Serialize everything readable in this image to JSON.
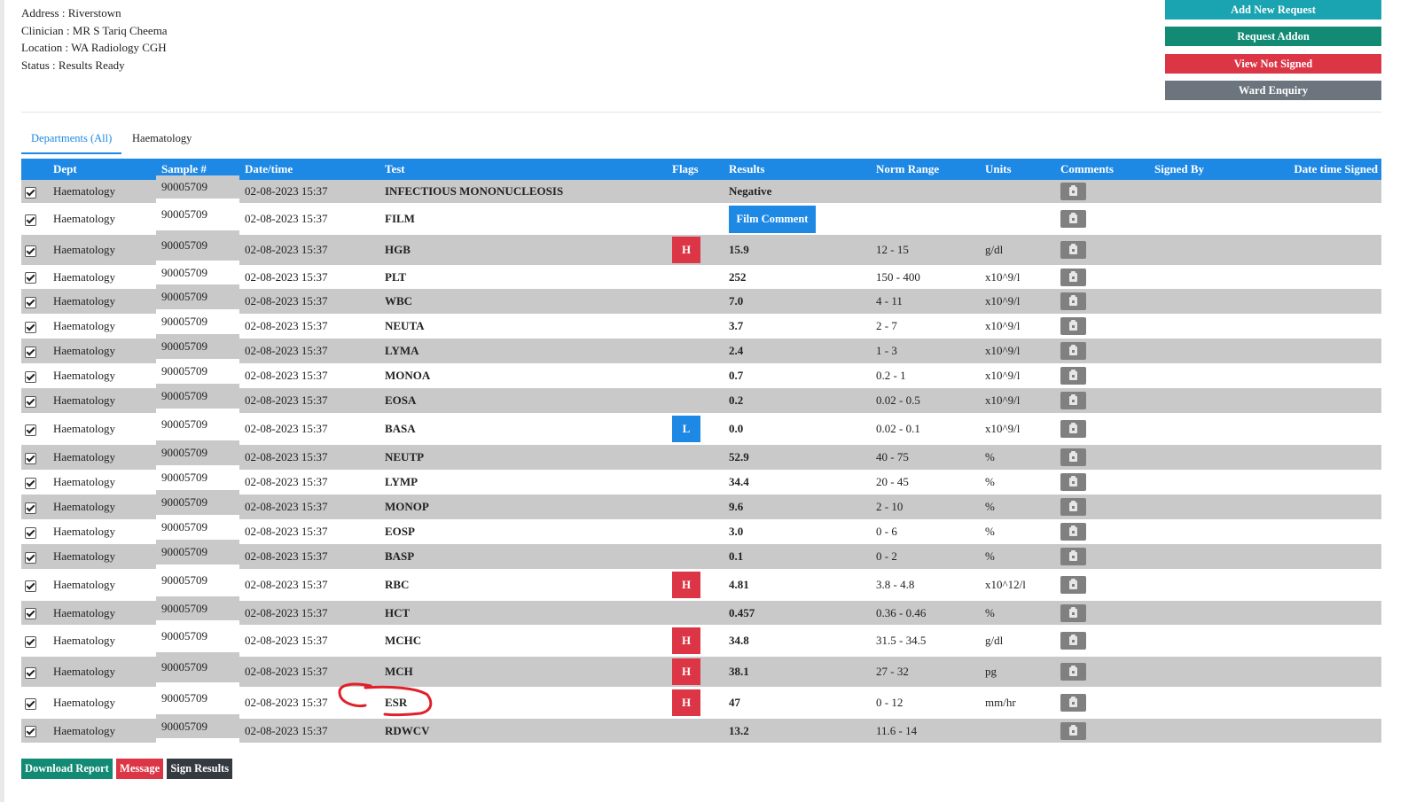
{
  "patient_info": {
    "address": "Address : Riverstown",
    "clinician": "Clinician : MR S Tariq Cheema",
    "location": "Location : WA Radiology CGH",
    "status": "Status : Results Ready"
  },
  "actions": {
    "add_new_request": "Add New Request",
    "request_addon": "Request Addon",
    "view_not_signed": "View Not Signed",
    "ward_enquiry": "Ward Enquiry"
  },
  "tabs": [
    {
      "label": "Departments (All)",
      "active": true
    },
    {
      "label": "Haematology",
      "active": false
    }
  ],
  "table": {
    "columns": [
      "",
      "Dept",
      "Sample #",
      "Date/time",
      "Test",
      "Flags",
      "Results",
      "Norm Range",
      "Units",
      "Comments",
      "Signed By",
      "Date time Signed"
    ],
    "rows": [
      {
        "dept": "Haematology",
        "sample": "90005709",
        "datetime": "02-08-2023 15:37",
        "test": "INFECTIOUS MONONUCLEOSIS",
        "flag": "",
        "result": "Negative",
        "range": "",
        "units": ""
      },
      {
        "dept": "Haematology",
        "sample": "90005709",
        "datetime": "02-08-2023 15:37",
        "test": "FILM",
        "flag": "",
        "result": "",
        "result_button": "Film Comment",
        "range": "",
        "units": ""
      },
      {
        "dept": "Haematology",
        "sample": "90005709",
        "datetime": "02-08-2023 15:37",
        "test": "HGB",
        "flag": "H",
        "result": "15.9",
        "range": "12 - 15",
        "units": "g/dl"
      },
      {
        "dept": "Haematology",
        "sample": "90005709",
        "datetime": "02-08-2023 15:37",
        "test": "PLT",
        "flag": "",
        "result": "252",
        "range": "150 - 400",
        "units": "x10^9/l"
      },
      {
        "dept": "Haematology",
        "sample": "90005709",
        "datetime": "02-08-2023 15:37",
        "test": "WBC",
        "flag": "",
        "result": "7.0",
        "range": "4 - 11",
        "units": "x10^9/l"
      },
      {
        "dept": "Haematology",
        "sample": "90005709",
        "datetime": "02-08-2023 15:37",
        "test": "NEUTA",
        "flag": "",
        "result": "3.7",
        "range": "2 - 7",
        "units": "x10^9/l"
      },
      {
        "dept": "Haematology",
        "sample": "90005709",
        "datetime": "02-08-2023 15:37",
        "test": "LYMA",
        "flag": "",
        "result": "2.4",
        "range": "1 - 3",
        "units": "x10^9/l"
      },
      {
        "dept": "Haematology",
        "sample": "90005709",
        "datetime": "02-08-2023 15:37",
        "test": "MONOA",
        "flag": "",
        "result": "0.7",
        "range": "0.2 - 1",
        "units": "x10^9/l"
      },
      {
        "dept": "Haematology",
        "sample": "90005709",
        "datetime": "02-08-2023 15:37",
        "test": "EOSA",
        "flag": "",
        "result": "0.2",
        "range": "0.02 - 0.5",
        "units": "x10^9/l"
      },
      {
        "dept": "Haematology",
        "sample": "90005709",
        "datetime": "02-08-2023 15:37",
        "test": "BASA",
        "flag": "L",
        "result": "0.0",
        "range": "0.02 - 0.1",
        "units": "x10^9/l"
      },
      {
        "dept": "Haematology",
        "sample": "90005709",
        "datetime": "02-08-2023 15:37",
        "test": "NEUTP",
        "flag": "",
        "result": "52.9",
        "range": "40 - 75",
        "units": "%"
      },
      {
        "dept": "Haematology",
        "sample": "90005709",
        "datetime": "02-08-2023 15:37",
        "test": "LYMP",
        "flag": "",
        "result": "34.4",
        "range": "20 - 45",
        "units": "%"
      },
      {
        "dept": "Haematology",
        "sample": "90005709",
        "datetime": "02-08-2023 15:37",
        "test": "MONOP",
        "flag": "",
        "result": "9.6",
        "range": "2 - 10",
        "units": "%"
      },
      {
        "dept": "Haematology",
        "sample": "90005709",
        "datetime": "02-08-2023 15:37",
        "test": "EOSP",
        "flag": "",
        "result": "3.0",
        "range": "0 - 6",
        "units": "%"
      },
      {
        "dept": "Haematology",
        "sample": "90005709",
        "datetime": "02-08-2023 15:37",
        "test": "BASP",
        "flag": "",
        "result": "0.1",
        "range": "0 - 2",
        "units": "%"
      },
      {
        "dept": "Haematology",
        "sample": "90005709",
        "datetime": "02-08-2023 15:37",
        "test": "RBC",
        "flag": "H",
        "result": "4.81",
        "range": "3.8 - 4.8",
        "units": "x10^12/l"
      },
      {
        "dept": "Haematology",
        "sample": "90005709",
        "datetime": "02-08-2023 15:37",
        "test": "HCT",
        "flag": "",
        "result": "0.457",
        "range": "0.36 - 0.46",
        "units": "%"
      },
      {
        "dept": "Haematology",
        "sample": "90005709",
        "datetime": "02-08-2023 15:37",
        "test": "MCHC",
        "flag": "H",
        "result": "34.8",
        "range": "31.5 - 34.5",
        "units": "g/dl"
      },
      {
        "dept": "Haematology",
        "sample": "90005709",
        "datetime": "02-08-2023 15:37",
        "test": "MCH",
        "flag": "H",
        "result": "38.1",
        "range": "27 - 32",
        "units": "pg"
      },
      {
        "dept": "Haematology",
        "sample": "90005709",
        "datetime": "02-08-2023 15:37",
        "test": "ESR",
        "flag": "H",
        "result": "47",
        "range": "0 - 12",
        "units": "mm/hr"
      },
      {
        "dept": "Haematology",
        "sample": "90005709",
        "datetime": "02-08-2023 15:37",
        "test": "RDWCV",
        "flag": "",
        "result": "13.2",
        "range": "11.6 - 14",
        "units": ""
      }
    ]
  },
  "bottom_actions": {
    "download_report": "Download Report",
    "message": "Message",
    "sign_results": "Sign Results"
  },
  "colors": {
    "header_blue": "#1e88e5",
    "flag_high": "#dc3545",
    "flag_low": "#1e88e5",
    "row_stripe": "#c9c9c9",
    "annotation_red": "#e0202a"
  }
}
